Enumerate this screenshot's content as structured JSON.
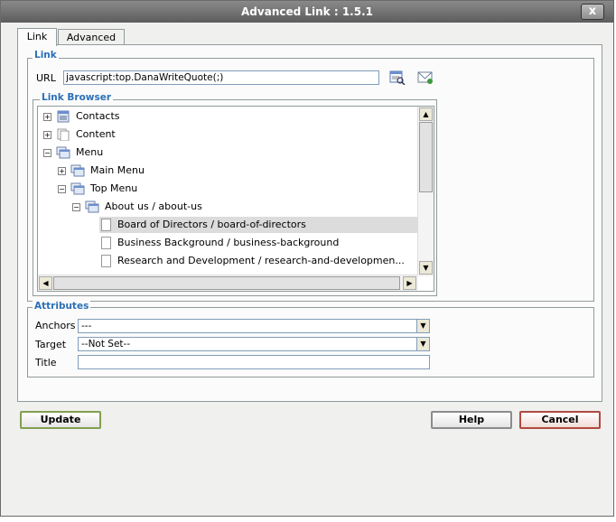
{
  "window": {
    "title": "Advanced Link : 1.5.1",
    "close_label": "x"
  },
  "tabs": [
    {
      "label": "Link",
      "active": true
    },
    {
      "label": "Advanced",
      "active": false
    }
  ],
  "link_section": {
    "legend": "Link",
    "url_label": "URL",
    "url_value": "javascript:top.DanaWriteQuote(;)",
    "browse_icon": "browse-icon",
    "email_icon": "email-icon"
  },
  "link_browser": {
    "legend": "Link Browser",
    "nodes": [
      {
        "label": "Contacts",
        "toggle": "+",
        "icon": "contacts-icon"
      },
      {
        "label": "Content",
        "toggle": "+",
        "icon": "content-icon"
      },
      {
        "label": "Menu",
        "toggle": "-",
        "icon": "menu-icon"
      },
      {
        "label": "Main Menu",
        "toggle": "+",
        "icon": "menu-icon"
      },
      {
        "label": "Top Menu",
        "toggle": "-",
        "icon": "menu-icon"
      },
      {
        "label": "About us / about-us",
        "toggle": "-",
        "icon": "menu-icon"
      },
      {
        "label": "Board of Directors / board-of-directors",
        "icon": "page-icon",
        "selected": true
      },
      {
        "label": "Business Background / business-background",
        "icon": "page-icon"
      },
      {
        "label": "Research and Development / research-and-developmen...",
        "icon": "page-icon"
      }
    ]
  },
  "attributes": {
    "legend": "Attributes",
    "anchors_label": "Anchors",
    "anchors_value": "---",
    "target_label": "Target",
    "target_value": "--Not Set--",
    "title_label": "Title",
    "title_value": ""
  },
  "buttons": {
    "update": "Update",
    "help": "Help",
    "cancel": "Cancel"
  }
}
